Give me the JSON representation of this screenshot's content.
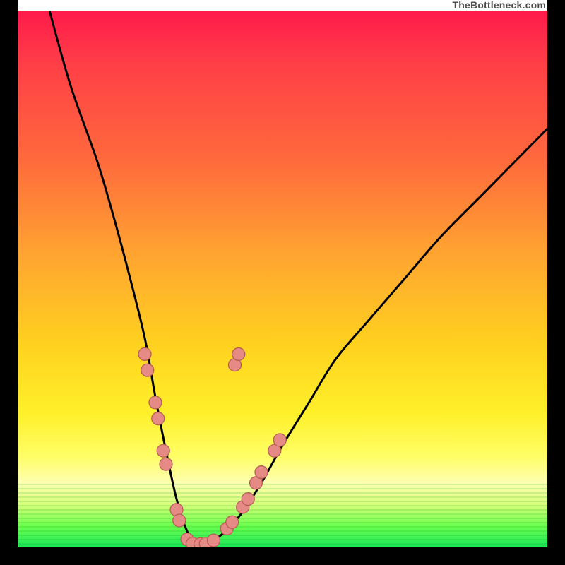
{
  "watermark": "TheBottleneck.com",
  "chart_data": {
    "type": "line",
    "title": "",
    "xlabel": "",
    "ylabel": "",
    "xlim": [
      0,
      100
    ],
    "ylim": [
      0,
      100
    ],
    "grid": false,
    "legend": false,
    "series": [
      {
        "name": "bottleneck-curve",
        "x": [
          6,
          10,
          15,
          18,
          21,
          24,
          26,
          28,
          30,
          32,
          34,
          38,
          42,
          46,
          50,
          55,
          60,
          66,
          73,
          80,
          88,
          96,
          100
        ],
        "values": [
          100,
          86,
          72,
          62,
          51,
          39,
          28,
          18,
          9,
          3,
          0.5,
          2,
          6,
          12,
          19,
          27,
          35,
          42,
          50,
          58,
          66,
          74,
          78
        ]
      }
    ],
    "markers": [
      {
        "x": 24.0,
        "y": 36
      },
      {
        "x": 24.5,
        "y": 33
      },
      {
        "x": 26.0,
        "y": 27
      },
      {
        "x": 26.5,
        "y": 24
      },
      {
        "x": 27.5,
        "y": 18
      },
      {
        "x": 28.0,
        "y": 15.5
      },
      {
        "x": 30.0,
        "y": 7
      },
      {
        "x": 30.5,
        "y": 5
      },
      {
        "x": 32.0,
        "y": 1.5
      },
      {
        "x": 33.0,
        "y": 0.7
      },
      {
        "x": 34.5,
        "y": 0.6
      },
      {
        "x": 35.5,
        "y": 0.7
      },
      {
        "x": 37.0,
        "y": 1.3
      },
      {
        "x": 39.5,
        "y": 3.5
      },
      {
        "x": 40.5,
        "y": 4.7
      },
      {
        "x": 42.5,
        "y": 7.5
      },
      {
        "x": 43.5,
        "y": 9
      },
      {
        "x": 45.0,
        "y": 12
      },
      {
        "x": 46.0,
        "y": 14
      },
      {
        "x": 48.5,
        "y": 18
      },
      {
        "x": 49.5,
        "y": 20
      },
      {
        "x": 41.0,
        "y": 34
      },
      {
        "x": 41.7,
        "y": 36
      }
    ],
    "marker_style": {
      "fill": "#e68a85",
      "stroke": "#b35a55",
      "r": 9
    },
    "curve_style": {
      "stroke": "#000000",
      "width": 3
    },
    "background_gradient": {
      "stops": [
        {
          "pos": 0,
          "color": "#ff1a4b"
        },
        {
          "pos": 28,
          "color": "#ff6a3c"
        },
        {
          "pos": 62,
          "color": "#ffd11f"
        },
        {
          "pos": 88,
          "color": "#fdffb0"
        },
        {
          "pos": 100,
          "color": "#18e85a"
        }
      ]
    }
  }
}
